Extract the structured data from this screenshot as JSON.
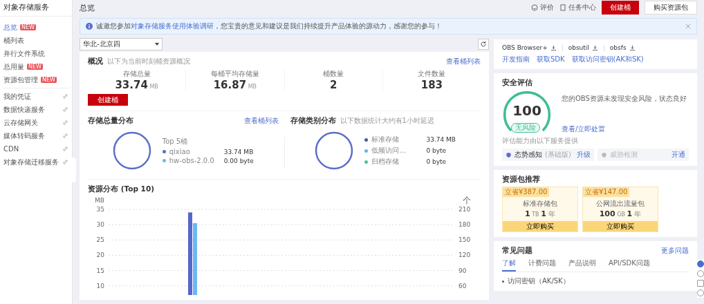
{
  "sidebar": {
    "title": "对象存储服务",
    "items": [
      {
        "label": "总览",
        "badge": "NEW",
        "selected": true,
        "kind": "nav"
      },
      {
        "label": "桶列表",
        "selected": false,
        "kind": "nav"
      },
      {
        "label": "并行文件系统",
        "selected": false,
        "kind": "nav"
      },
      {
        "label": "总用量",
        "badge": "NEW",
        "selected": false,
        "kind": "nav"
      },
      {
        "label": "资源包管理",
        "badge": "NEW",
        "selected": false,
        "kind": "nav"
      },
      {
        "label": "我的凭证",
        "selected": false,
        "kind": "external"
      },
      {
        "label": "数据快递服务",
        "selected": false,
        "kind": "external"
      },
      {
        "label": "云存储网关",
        "selected": false,
        "kind": "external"
      },
      {
        "label": "媒体转码服务",
        "selected": false,
        "kind": "external"
      },
      {
        "label": "CDN",
        "selected": false,
        "kind": "external"
      },
      {
        "label": "对象存储迁移服务",
        "selected": false,
        "kind": "external"
      }
    ]
  },
  "header": {
    "title": "总览",
    "rate": "评价",
    "tasks": "任务中心",
    "create": "创建桶",
    "buy": "购买资源包"
  },
  "banner": {
    "before": "诚邀您参加",
    "link": "对象存储服务使用体验调研",
    "after": "，您宝贵的意见和建议是我们持续提升产品体验的源动力，感谢您的参与！"
  },
  "region": {
    "value": "华北-北京四"
  },
  "overview": {
    "title": "概况",
    "subtitle": "以下为当前时刻桶资源概况",
    "link": "查看桶列表",
    "create": "创建桶",
    "stats": [
      {
        "label": "存储总量",
        "value": "33.74",
        "unit": "MB"
      },
      {
        "label": "每桶平均存储量",
        "value": "16.87",
        "unit": "MB"
      },
      {
        "label": "桶数量",
        "value": "2"
      },
      {
        "label": "文件数量",
        "value": "183"
      }
    ]
  },
  "storage_dist": {
    "title": "存储总量分布",
    "link": "查看桶列表",
    "legend_title": "Top 5桶",
    "legend": [
      {
        "name": "qixiao",
        "value": "33.74  MB",
        "color": "#5b6fc9"
      },
      {
        "name": "hw-obs-2.0.0",
        "value": "0.00  byte",
        "color": "#69c0e0"
      }
    ]
  },
  "class_dist": {
    "title": "存储类别分布",
    "subtitle": "以下数据统计大约有1小时延迟",
    "legend": [
      {
        "name": "标准存储",
        "value": "33.74  MB",
        "color": "#4a58a8"
      },
      {
        "name": "低频访问...",
        "value": "0  byte",
        "color": "#69b4ef"
      },
      {
        "name": "归档存储",
        "value": "0  byte",
        "color": "#4cc3a0"
      }
    ]
  },
  "resource": {
    "title": "资源分布 (Top 10)",
    "chart_data": {
      "type": "bar",
      "ylabel": "MB",
      "ylim": [
        7,
        35
      ],
      "yticks": [
        10,
        15,
        20,
        25,
        30,
        35
      ],
      "y2label": "个",
      "y2lim": [
        42,
        210
      ],
      "y2ticks": [
        60,
        90,
        120,
        150,
        180,
        210
      ],
      "grid": true,
      "series": [
        {
          "color": "#5468c8",
          "axis": "y",
          "values": [
            34
          ]
        },
        {
          "color": "#6cb6f2",
          "axis": "y2",
          "values": [
            183
          ]
        }
      ]
    }
  },
  "tools": {
    "downloads": [
      "OBS Browser+",
      "obsutil",
      "obsfs"
    ],
    "links": [
      "开发指南",
      "获取SDK",
      "获取访问密钥(AK和SK)"
    ]
  },
  "security": {
    "title": "安全评估",
    "score": "100",
    "risk": "无风险",
    "message": "您的OBS资源未发现安全风险，状态良好",
    "link": "查看/立即处置",
    "note": "评估能力由以下服务提供",
    "services": [
      {
        "name": "态势感知",
        "tag": "(基础版)",
        "action": "升级",
        "disabled": false
      },
      {
        "name": "威胁检测",
        "action": "开通",
        "disabled": true
      }
    ]
  },
  "packages": {
    "title": "资源包推荐",
    "items": [
      {
        "saving": "立省¥387.00",
        "name": "标准存储包",
        "size": "1",
        "size_unit": "TB",
        "term": "1",
        "term_unit": "年",
        "buy": "立即购买"
      },
      {
        "saving": "立省¥147.00",
        "name": "公网流出流量包",
        "size": "100",
        "size_unit": "GB",
        "term": "1",
        "term_unit": "年",
        "buy": "立即购买"
      }
    ]
  },
  "faq": {
    "title": "常见问题",
    "more": "更多问题",
    "tabs": [
      {
        "label": "了解",
        "selected": true
      },
      {
        "label": "计费问题",
        "selected": false
      },
      {
        "label": "产品说明",
        "selected": false
      },
      {
        "label": "API/SDK问题",
        "selected": false
      }
    ],
    "items": [
      "访问密钥（AK/SK）"
    ]
  }
}
